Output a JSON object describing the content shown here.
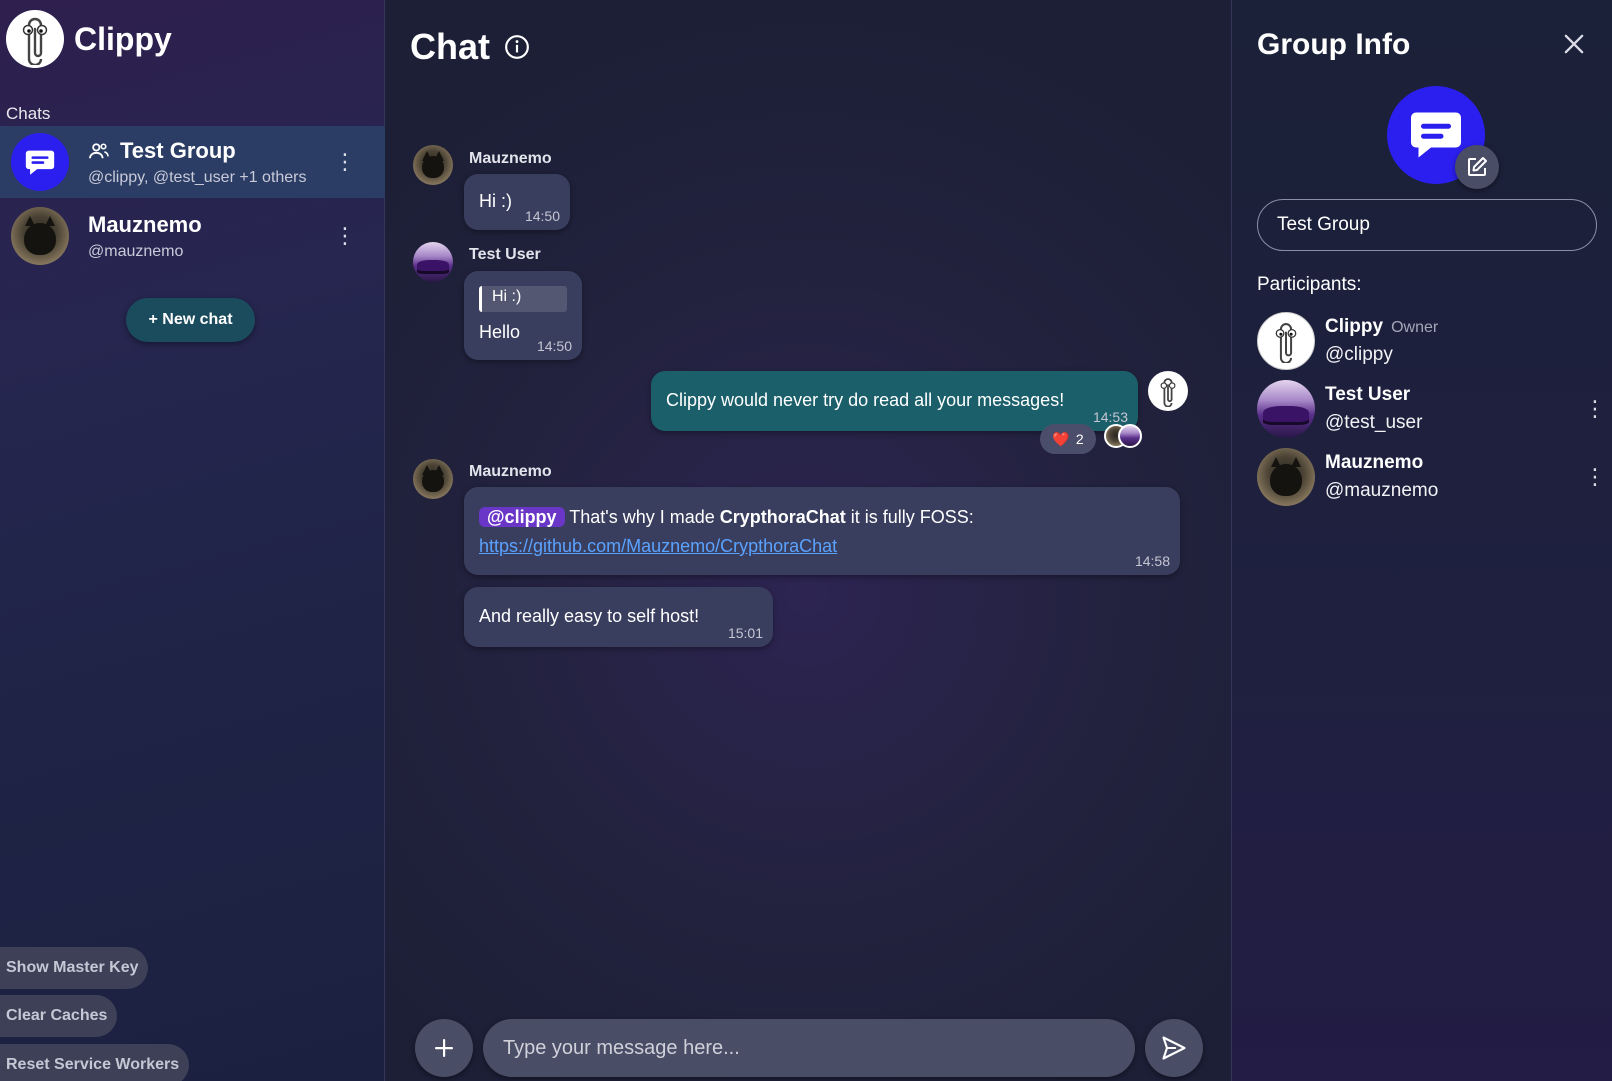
{
  "brand": {
    "name": "Clippy"
  },
  "sidebar": {
    "heading": "Chats",
    "chats": [
      {
        "title": "Test Group",
        "subtitle": "@clippy, @test_user +1 others",
        "icon": "group-icon",
        "active": true
      },
      {
        "title": "Mauznemo",
        "subtitle": "@mauznemo",
        "active": false
      }
    ],
    "new_chat_label": "+ New chat",
    "bottom_buttons": [
      "Show Master Key",
      "Clear Caches",
      "Reset Service Workers"
    ]
  },
  "chat": {
    "title": "Chat",
    "messages": [
      {
        "sender": "Mauznemo",
        "text": "Hi :)",
        "time": "14:50"
      },
      {
        "sender": "Test User",
        "reply_to": "Hi :)",
        "text": "Hello",
        "time": "14:50"
      },
      {
        "sender": "Clippy",
        "own": true,
        "text": "Clippy would never try do read all your messages!",
        "time": "14:53",
        "reaction": {
          "emoji": "❤️",
          "count": "2"
        }
      },
      {
        "sender": "Mauznemo",
        "mention": "@clippy",
        "text_before_bold": "That's why I made ",
        "bold": "CrypthoraChat",
        "text_after_bold": " it is fully FOSS:",
        "link": "https://github.com/Mauznemo/CrypthoraChat",
        "time": "14:58"
      },
      {
        "sender": "Mauznemo",
        "text": "And really easy to self host!",
        "time": "15:01"
      }
    ],
    "input_placeholder": "Type your message here..."
  },
  "group_info": {
    "title": "Group Info",
    "group_name": "Test Group",
    "participants_label": "Participants:",
    "participants": [
      {
        "name": "Clippy",
        "role": "Owner",
        "handle": "@clippy"
      },
      {
        "name": "Test User",
        "role": "",
        "handle": "@test_user"
      },
      {
        "name": "Mauznemo",
        "role": "",
        "handle": "@mauznemo"
      }
    ]
  },
  "colors": {
    "accent_teal": "#1b5f6a",
    "group_avatar": "#2b1ff0",
    "mention": "#6a36c8",
    "link": "#5aa2ff"
  }
}
